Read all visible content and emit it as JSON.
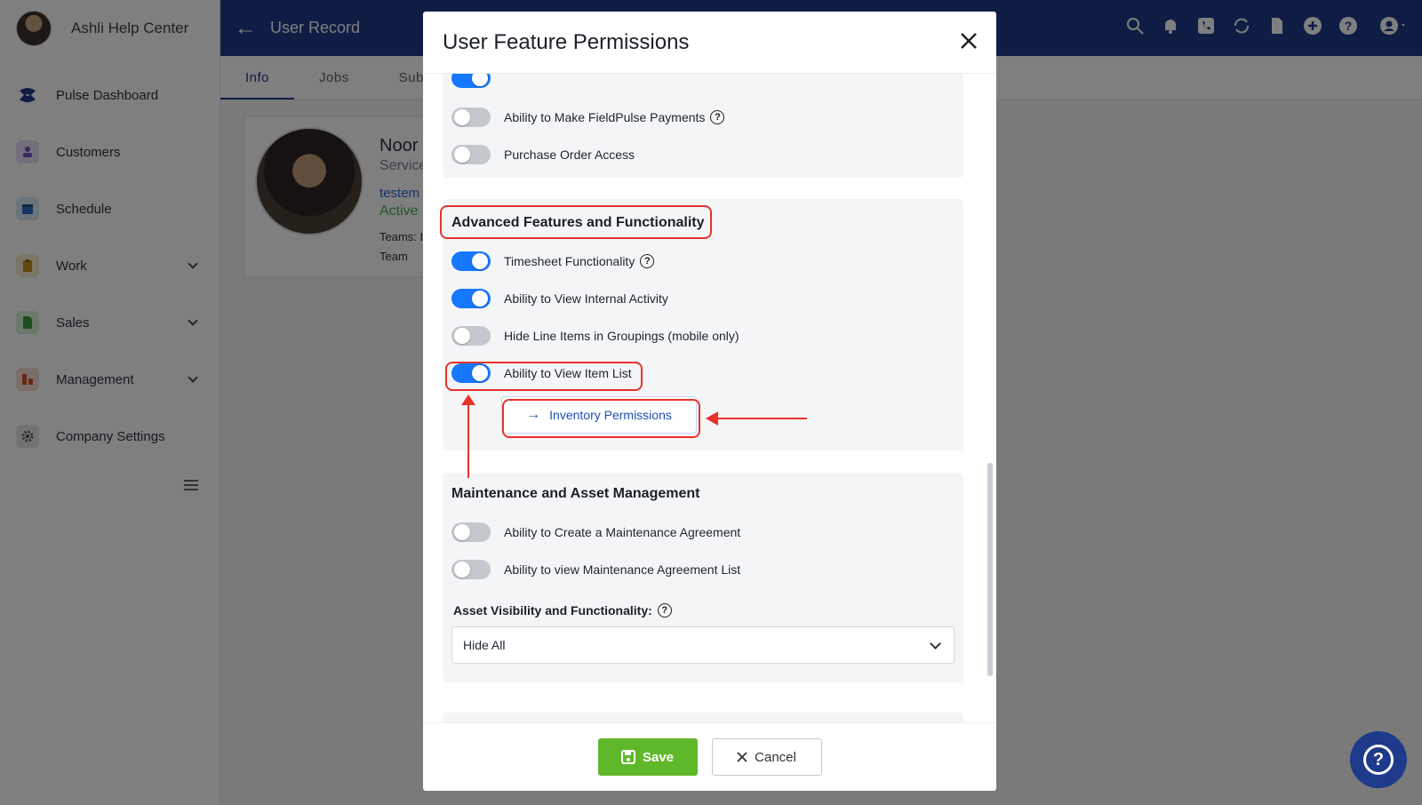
{
  "sidebar": {
    "title": "Ashli Help Center",
    "items": [
      {
        "label": "Pulse Dashboard",
        "icon": "pulse-logo-icon"
      },
      {
        "label": "Customers",
        "icon": "customers-icon"
      },
      {
        "label": "Schedule",
        "icon": "calendar-icon"
      },
      {
        "label": "Work",
        "icon": "clipboard-icon"
      },
      {
        "label": "Sales",
        "icon": "document-dollar-icon"
      },
      {
        "label": "Management",
        "icon": "management-icon"
      },
      {
        "label": "Company Settings",
        "icon": "gear-icon"
      }
    ]
  },
  "header": {
    "title": "User Record",
    "icons": [
      "search-icon",
      "bell-icon",
      "phone-icon",
      "sync-icon",
      "document-icon",
      "plus-circle-icon",
      "help-circle-icon",
      "user-account-icon"
    ]
  },
  "tabs": [
    "Info",
    "Jobs",
    "Subt"
  ],
  "profile": {
    "name": "Noor",
    "role": "Service",
    "email": "testem",
    "status": "Active",
    "teams_label": "Teams: I",
    "team_line": "Team"
  },
  "modal": {
    "title": "User Feature Permissions",
    "top_rows": [
      {
        "label": "Ability to Make FieldPulse Payments",
        "on": false,
        "help": true
      },
      {
        "label": "Purchase Order Access",
        "on": false,
        "help": false
      }
    ],
    "advanced": {
      "title": "Advanced Features and Functionality",
      "rows": [
        {
          "label": "Timesheet Functionality",
          "on": true,
          "help": true
        },
        {
          "label": "Ability to View Internal Activity",
          "on": true,
          "help": false
        },
        {
          "label": "Hide Line Items in Groupings (mobile only)",
          "on": false,
          "help": false
        },
        {
          "label": "Ability to View Item List",
          "on": true,
          "help": false
        }
      ],
      "inventory_button": "Inventory Permissions"
    },
    "maintenance": {
      "title": "Maintenance and Asset Management",
      "rows": [
        {
          "label": "Ability to Create a Maintenance Agreement",
          "on": false
        },
        {
          "label": "Ability to view Maintenance Agreement List",
          "on": false
        }
      ],
      "asset_label": "Asset Visibility and Functionality:",
      "asset_value": "Hide All"
    },
    "save_label": "Save",
    "cancel_label": "Cancel"
  },
  "colors": {
    "brand": "#1e3a8a",
    "toggle_on": "#1677ff",
    "save": "#5fb82a",
    "annotation": "#e8322a"
  }
}
